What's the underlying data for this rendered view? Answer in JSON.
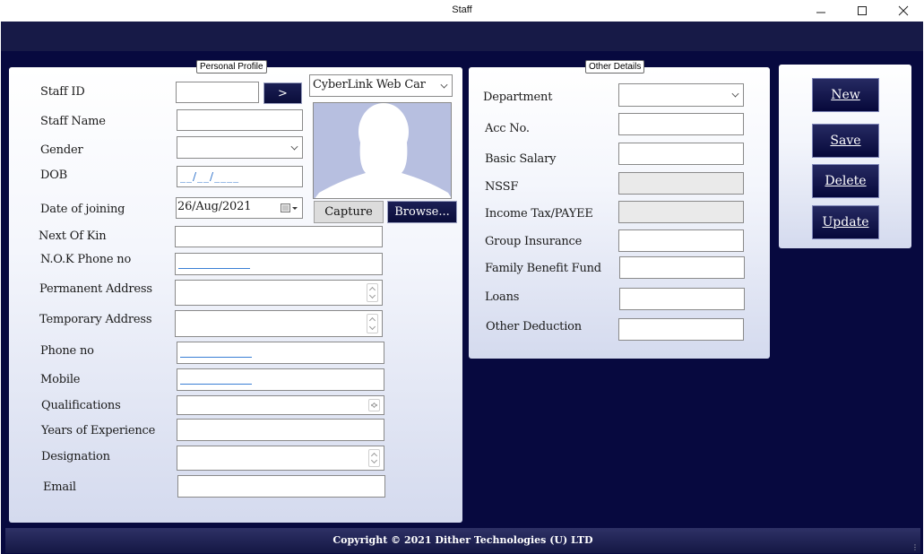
{
  "window": {
    "title": "Staff"
  },
  "personal_profile": {
    "group_title": "Personal Profile",
    "staff_id_label": "Staff ID",
    "staff_id_value": "",
    "go_button": ">",
    "camera_select": "CyberLink Web Car",
    "staff_name_label": "Staff Name",
    "staff_name_value": "",
    "gender_label": "Gender",
    "gender_value": "",
    "dob_label": "DOB",
    "dob_mask": "__/__/____",
    "date_joining_label": "Date of joining",
    "date_joining_value": "26/Aug/2021",
    "capture_button": "Capture",
    "browse_button": "Browse...",
    "next_of_kin_label": "Next Of Kin",
    "next_of_kin_value": "",
    "nok_phone_label": "N.O.K Phone no",
    "permanent_address_label": "Permanent Address",
    "temporary_address_label": "Temporary Address",
    "phone_label": "Phone no",
    "mobile_label": "Mobile",
    "qualifications_label": "Qualifications",
    "years_experience_label": "Years of Experience",
    "designation_label": "Designation",
    "email_label": "Email"
  },
  "other_details": {
    "group_title": "Other Details",
    "department_label": "Department",
    "acc_no_label": "Acc No.",
    "basic_salary_label": "Basic Salary",
    "nssf_label": "NSSF",
    "income_tax_label": "Income Tax/PAYEE",
    "group_insurance_label": "Group Insurance",
    "family_benefit_label": "Family Benefit Fund",
    "loans_label": "Loans",
    "other_deduction_label": "Other Deduction"
  },
  "actions": {
    "new_label": "New",
    "save_label": "Save",
    "delete_label": "Delete",
    "update_label": "Update"
  },
  "footer": {
    "copyright": "Copyright ©  2021 Dither Technologies (U) LTD"
  },
  "colors": {
    "window_background": "#07093f",
    "panel_gradient_top": "#ffffff",
    "panel_gradient_bottom": "#d4daee",
    "button_navy": "#0a0d3a",
    "mask_blue": "#2a6fc9"
  },
  "icons": [
    "minimize-icon",
    "maximize-icon",
    "close-icon",
    "chevron-down-icon",
    "calendar-icon",
    "person-silhouette-icon",
    "spinner-icon"
  ]
}
